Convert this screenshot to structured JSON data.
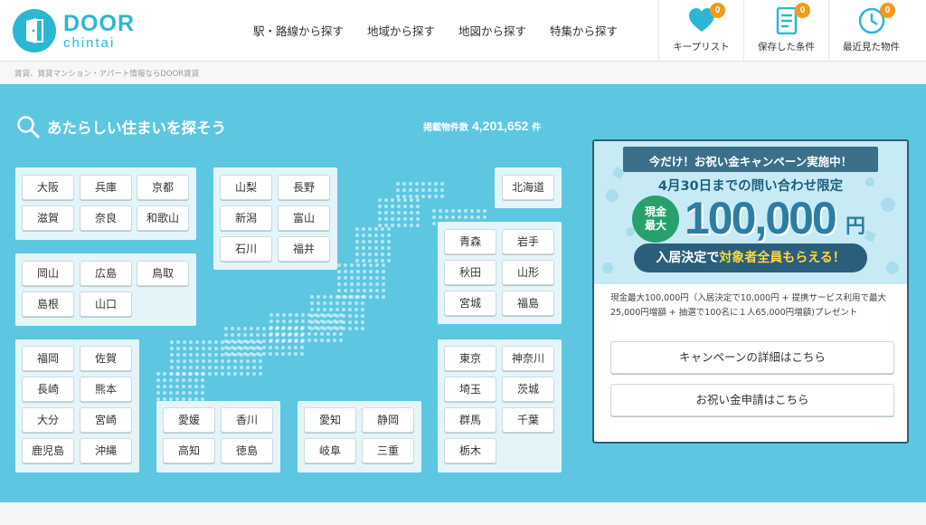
{
  "header": {
    "logo_main": "DOOR",
    "logo_sub": "chintai",
    "nav": [
      {
        "label": "駅・路線から探す"
      },
      {
        "label": "地域から探す"
      },
      {
        "label": "地図から探す"
      },
      {
        "label": "特集から探す"
      }
    ],
    "buttons": [
      {
        "label": "キープリスト",
        "badge": "0",
        "icon": "heart-icon"
      },
      {
        "label": "保存した条件",
        "badge": "0",
        "icon": "document-icon"
      },
      {
        "label": "最近見た物件",
        "badge": "0",
        "icon": "clock-icon"
      }
    ],
    "tagline": "賃貸、賃貸マンション・アパート情報ならDOOR賃貸"
  },
  "hero": {
    "title": "あたらしい住まいを探そう",
    "count_label": "掲載物件数",
    "count_value": "4,201,652",
    "count_unit": "件"
  },
  "regions": {
    "kansai": [
      "大阪",
      "兵庫",
      "京都",
      "滋賀",
      "奈良",
      "和歌山"
    ],
    "chugoku": [
      "岡山",
      "広島",
      "鳥取",
      "島根",
      "山口"
    ],
    "kyushu": [
      "福岡",
      "佐賀",
      "長崎",
      "熊本",
      "大分",
      "宮崎",
      "鹿児島",
      "沖縄"
    ],
    "koshinetsu": [
      "山梨",
      "長野",
      "新潟",
      "富山",
      "石川",
      "福井"
    ],
    "shikoku": [
      "愛媛",
      "香川",
      "高知",
      "徳島"
    ],
    "tokai": [
      "愛知",
      "静岡",
      "岐阜",
      "三重"
    ],
    "hokkaido": [
      "北海道"
    ],
    "tohoku": [
      "青森",
      "岩手",
      "秋田",
      "山形",
      "宮城",
      "福島"
    ],
    "kanto": [
      "東京",
      "神奈川",
      "埼玉",
      "茨城",
      "群馬",
      "千葉",
      "栃木"
    ]
  },
  "campaign": {
    "ribbon": "今だけ！お祝い金キャンペーン実施中！",
    "limited": "4月30日までの問い合わせ限定",
    "circle_line1": "現金",
    "circle_line2": "最大",
    "amount": "100,000",
    "amount_unit": "円",
    "everyone_pre": "入居決定で",
    "everyone_hl": "対象者全員もらえる！",
    "description": "現金最大100,000円（入居決定で10,000円 + 提携サービス利用で最大25,000円増額 + 抽選で100名に１人65,000円増額)プレゼント",
    "detail_button": "キャンペーンの詳細はこちら",
    "apply_button": "お祝い金申請はこちら"
  },
  "colors": {
    "brand": "#2bb7d4",
    "hero_bg": "#5dc7e1",
    "badge": "#f39a1a",
    "campaign_border": "#2b5e7a"
  }
}
